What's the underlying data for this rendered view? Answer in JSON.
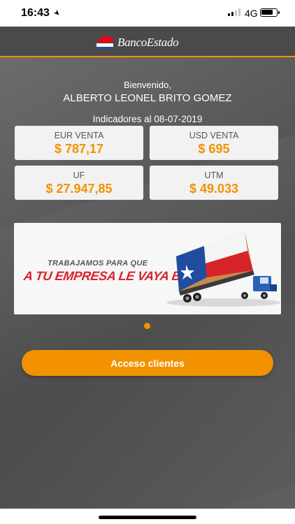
{
  "status_bar": {
    "time": "16:43",
    "network": "4G",
    "battery_level": 0.75
  },
  "header": {
    "brand": "BancoEstado"
  },
  "greeting": {
    "welcome": "Bienvenido,",
    "user_name": "ALBERTO LEONEL BRITO GOMEZ"
  },
  "indicators": {
    "title": "Indicadores al 08-07-2019",
    "items": [
      {
        "label": "EUR VENTA",
        "value": "$ 787,17"
      },
      {
        "label": "USD VENTA",
        "value": "$ 695"
      },
      {
        "label": "UF",
        "value": "$ 27.947,85"
      },
      {
        "label": "UTM",
        "value": "$ 49.033"
      }
    ]
  },
  "banner": {
    "line1": "TRABAJAMOS PARA QUE",
    "line2": "A TU EMPRESA LE VAYA BIEN"
  },
  "carousel": {
    "active_index": 0,
    "count": 1
  },
  "actions": {
    "login_label": "Acceso clientes"
  },
  "colors": {
    "accent": "#f39200",
    "brand_red": "#e30613",
    "brand_blue": "#1e4f9c",
    "background": "#5a5a5a"
  }
}
